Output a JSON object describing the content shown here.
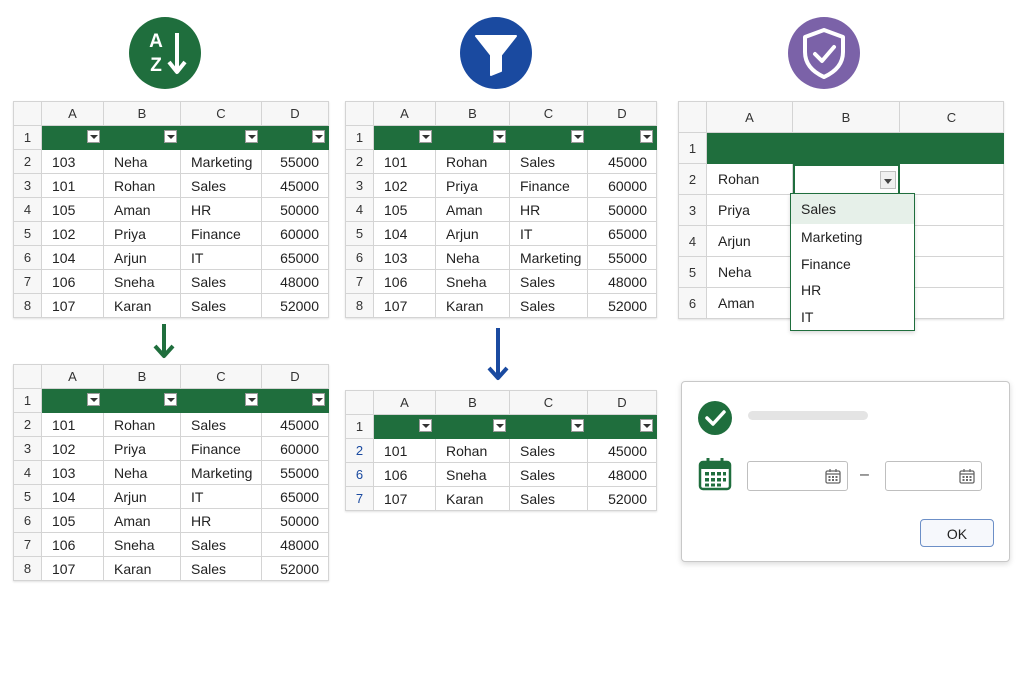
{
  "columns4": [
    "A",
    "B",
    "C",
    "D"
  ],
  "columns3": [
    "A",
    "B",
    "C"
  ],
  "sort_panel": {
    "icon_letters": [
      "A",
      "Z"
    ],
    "before": [
      {
        "r": "2",
        "id": "103",
        "name": "Neha",
        "dept": "Marketing",
        "sal": "55000"
      },
      {
        "r": "3",
        "id": "101",
        "name": "Rohan",
        "dept": "Sales",
        "sal": "45000"
      },
      {
        "r": "4",
        "id": "105",
        "name": "Aman",
        "dept": "HR",
        "sal": "50000"
      },
      {
        "r": "5",
        "id": "102",
        "name": "Priya",
        "dept": "Finance",
        "sal": "60000"
      },
      {
        "r": "6",
        "id": "104",
        "name": "Arjun",
        "dept": "IT",
        "sal": "65000"
      },
      {
        "r": "7",
        "id": "106",
        "name": "Sneha",
        "dept": "Sales",
        "sal": "48000"
      },
      {
        "r": "8",
        "id": "107",
        "name": "Karan",
        "dept": "Sales",
        "sal": "52000"
      }
    ],
    "after": [
      {
        "r": "2",
        "id": "101",
        "name": "Rohan",
        "dept": "Sales",
        "sal": "45000"
      },
      {
        "r": "3",
        "id": "102",
        "name": "Priya",
        "dept": "Finance",
        "sal": "60000"
      },
      {
        "r": "4",
        "id": "103",
        "name": "Neha",
        "dept": "Marketing",
        "sal": "55000"
      },
      {
        "r": "5",
        "id": "104",
        "name": "Arjun",
        "dept": "IT",
        "sal": "65000"
      },
      {
        "r": "6",
        "id": "105",
        "name": "Aman",
        "dept": "HR",
        "sal": "50000"
      },
      {
        "r": "7",
        "id": "106",
        "name": "Sneha",
        "dept": "Sales",
        "sal": "48000"
      },
      {
        "r": "8",
        "id": "107",
        "name": "Karan",
        "dept": "Sales",
        "sal": "52000"
      }
    ]
  },
  "filter_panel": {
    "before": [
      {
        "r": "2",
        "id": "101",
        "name": "Rohan",
        "dept": "Sales",
        "sal": "45000"
      },
      {
        "r": "3",
        "id": "102",
        "name": "Priya",
        "dept": "Finance",
        "sal": "60000"
      },
      {
        "r": "4",
        "id": "105",
        "name": "Aman",
        "dept": "HR",
        "sal": "50000"
      },
      {
        "r": "5",
        "id": "104",
        "name": "Arjun",
        "dept": "IT",
        "sal": "65000"
      },
      {
        "r": "6",
        "id": "103",
        "name": "Neha",
        "dept": "Marketing",
        "sal": "55000"
      },
      {
        "r": "7",
        "id": "106",
        "name": "Sneha",
        "dept": "Sales",
        "sal": "48000"
      },
      {
        "r": "8",
        "id": "107",
        "name": "Karan",
        "dept": "Sales",
        "sal": "52000"
      }
    ],
    "after": [
      {
        "r": "2",
        "id": "101",
        "name": "Rohan",
        "dept": "Sales",
        "sal": "45000"
      },
      {
        "r": "6",
        "id": "106",
        "name": "Sneha",
        "dept": "Sales",
        "sal": "48000"
      },
      {
        "r": "7",
        "id": "107",
        "name": "Karan",
        "dept": "Sales",
        "sal": "52000"
      }
    ]
  },
  "validation_panel": {
    "rows": [
      {
        "r": "2",
        "name": "Rohan"
      },
      {
        "r": "3",
        "name": "Priya"
      },
      {
        "r": "4",
        "name": "Arjun"
      },
      {
        "r": "5",
        "name": "Neha"
      },
      {
        "r": "6",
        "name": "Aman"
      }
    ],
    "dropdown_options": [
      "Sales",
      "Marketing",
      "Finance",
      "HR",
      "IT"
    ],
    "selected_option": "Sales"
  },
  "date_dialog": {
    "range_separator": "–",
    "ok_label": "OK"
  },
  "colors": {
    "green": "#1f6e3d",
    "blue": "#1a4aa0",
    "purple": "#7b62a8"
  },
  "icons": [
    "sort-az-icon",
    "filter-funnel-icon",
    "shield-check-icon",
    "down-arrow-icon",
    "check-circle-icon",
    "calendar-icon"
  ]
}
